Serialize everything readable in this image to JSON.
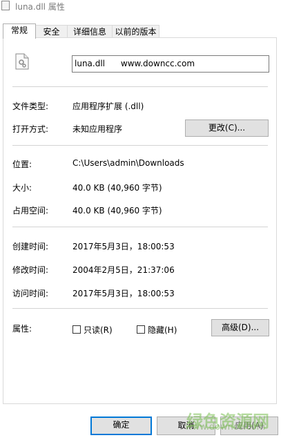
{
  "window": {
    "title": "luna.dll 属性"
  },
  "tabs": [
    {
      "label": "常规",
      "active": true
    },
    {
      "label": "安全",
      "active": false
    },
    {
      "label": "详细信息",
      "active": false
    },
    {
      "label": "以前的版本",
      "active": false
    }
  ],
  "file": {
    "icon": "dll-file-gear-icon",
    "name": "luna.dll      www.downcc.com"
  },
  "type": {
    "label": "文件类型:",
    "value": "应用程序扩展 (.dll)"
  },
  "open_with": {
    "label": "打开方式:",
    "value": "未知应用程序",
    "button": "更改(C)..."
  },
  "location": {
    "label": "位置:",
    "value": "C:\\Users\\admin\\Downloads"
  },
  "size": {
    "label": "大小:",
    "value": "40.0 KB (40,960 字节)"
  },
  "size_on_disk": {
    "label": "占用空间:",
    "value": "40.0 KB (40,960 字节)"
  },
  "created": {
    "label": "创建时间:",
    "value": "2017年5月3日，18:00:53"
  },
  "modified": {
    "label": "修改时间:",
    "value": "2004年2月5日，21:37:06"
  },
  "accessed": {
    "label": "访问时间:",
    "value": "2017年5月3日，18:00:53"
  },
  "attributes": {
    "label": "属性:",
    "readonly": {
      "label": "只读(R)",
      "checked": false
    },
    "hidden": {
      "label": "隐藏(H)",
      "checked": false
    },
    "advanced_button": "高级(D)..."
  },
  "footer": {
    "ok": "确定",
    "cancel": "取消",
    "apply": "应用(A)"
  },
  "watermark": {
    "text": "绿色资源网",
    "url": "www.downcc.com"
  },
  "colors": {
    "focus_border": "#0078d7",
    "button_bg": "#e1e1e1",
    "separator": "#d3d3d3"
  }
}
